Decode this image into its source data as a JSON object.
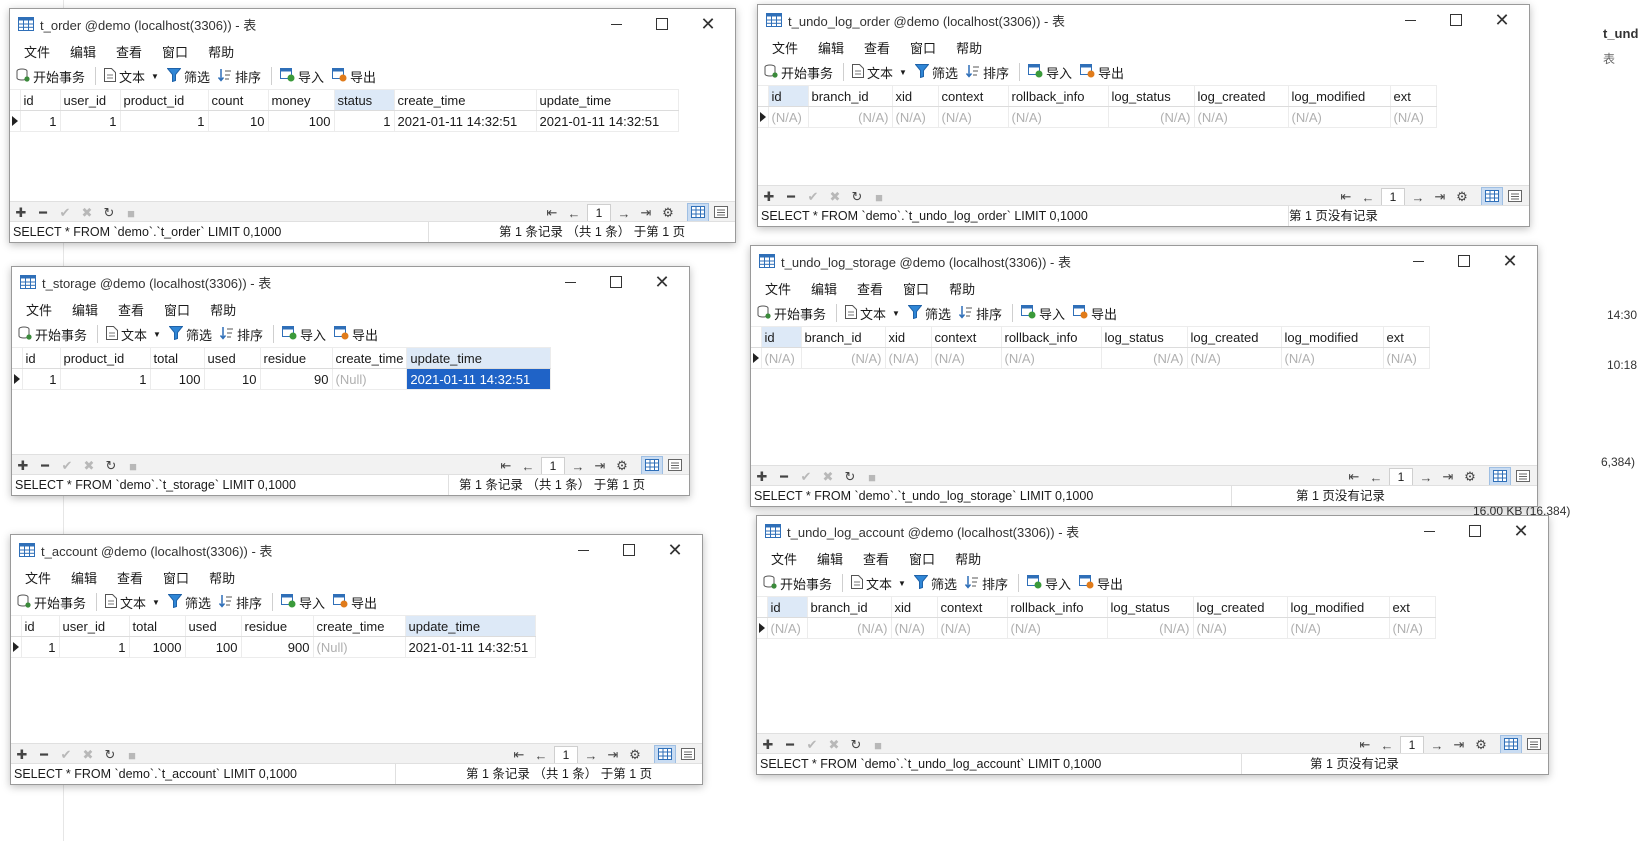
{
  "menu": [
    "文件",
    "编辑",
    "查看",
    "窗口",
    "帮助"
  ],
  "toolbar": {
    "begin_tx": "开始事务",
    "text": "文本",
    "filter": "筛选",
    "sort": "排序",
    "import": "导入",
    "export": "导出"
  },
  "nav": {
    "page": "1"
  },
  "background": {
    "t_und": "t_und",
    "biao": "表",
    "t1": "14:30",
    "t2": "10:18",
    "t3": "6,384)",
    "t4": "16.00 KB (16,384)"
  },
  "windows": {
    "t_order": {
      "title": "t_order @demo (localhost(3306)) - 表",
      "columns": [
        "id",
        "user_id",
        "product_id",
        "count",
        "money",
        "status",
        "create_time",
        "update_time"
      ],
      "row": [
        "1",
        "1",
        "1",
        "10",
        "100",
        "1",
        "2021-01-11 14:32:51",
        "2021-01-11 14:32:51"
      ],
      "sql": "SELECT * FROM `demo`.`t_order` LIMIT 0,1000",
      "info": "第 1 条记录 （共 1 条） 于第 1 页"
    },
    "t_storage": {
      "title": "t_storage @demo (localhost(3306)) - 表",
      "columns": [
        "id",
        "product_id",
        "total",
        "used",
        "residue",
        "create_time",
        "update_time"
      ],
      "row": [
        "1",
        "1",
        "100",
        "10",
        "90",
        "(Null)",
        "2021-01-11 14:32:51"
      ],
      "sql": "SELECT * FROM `demo`.`t_storage` LIMIT 0,1000",
      "info": "第 1 条记录 （共 1 条） 于第 1 页"
    },
    "t_account": {
      "title": "t_account @demo (localhost(3306)) - 表",
      "columns": [
        "id",
        "user_id",
        "total",
        "used",
        "residue",
        "create_time",
        "update_time"
      ],
      "row": [
        "1",
        "1",
        "1000",
        "100",
        "900",
        "(Null)",
        "2021-01-11 14:32:51"
      ],
      "sql": "SELECT * FROM `demo`.`t_account` LIMIT 0,1000",
      "info": "第 1 条记录 （共 1 条） 于第 1 页"
    },
    "t_undo_log_order": {
      "title": "t_undo_log_order @demo (localhost(3306)) - 表",
      "columns": [
        "id",
        "branch_id",
        "xid",
        "context",
        "rollback_info",
        "log_status",
        "log_created",
        "log_modified",
        "ext"
      ],
      "row": [
        "(N/A)",
        "(N/A)",
        "(N/A)",
        "(N/A)",
        "(N/A)",
        "(N/A)",
        "(N/A)",
        "(N/A)",
        "(N/A)"
      ],
      "sql": "SELECT * FROM `demo`.`t_undo_log_order` LIMIT 0,1000",
      "info": "第 1 页没有记录"
    },
    "t_undo_log_storage": {
      "title": "t_undo_log_storage @demo (localhost(3306)) - 表",
      "columns": [
        "id",
        "branch_id",
        "xid",
        "context",
        "rollback_info",
        "log_status",
        "log_created",
        "log_modified",
        "ext"
      ],
      "row": [
        "(N/A)",
        "(N/A)",
        "(N/A)",
        "(N/A)",
        "(N/A)",
        "(N/A)",
        "(N/A)",
        "(N/A)",
        "(N/A)"
      ],
      "sql": "SELECT * FROM `demo`.`t_undo_log_storage` LIMIT 0,1000",
      "info": "第 1 页没有记录"
    },
    "t_undo_log_account": {
      "title": "t_undo_log_account @demo (localhost(3306)) - 表",
      "columns": [
        "id",
        "branch_id",
        "xid",
        "context",
        "rollback_info",
        "log_status",
        "log_created",
        "log_modified",
        "ext"
      ],
      "row": [
        "(N/A)",
        "(N/A)",
        "(N/A)",
        "(N/A)",
        "(N/A)",
        "(N/A)",
        "(N/A)",
        "(N/A)",
        "(N/A)"
      ],
      "sql": "SELECT * FROM `demo`.`t_undo_log_account` LIMIT 0,1000",
      "info": "第 1 页没有记录"
    }
  }
}
